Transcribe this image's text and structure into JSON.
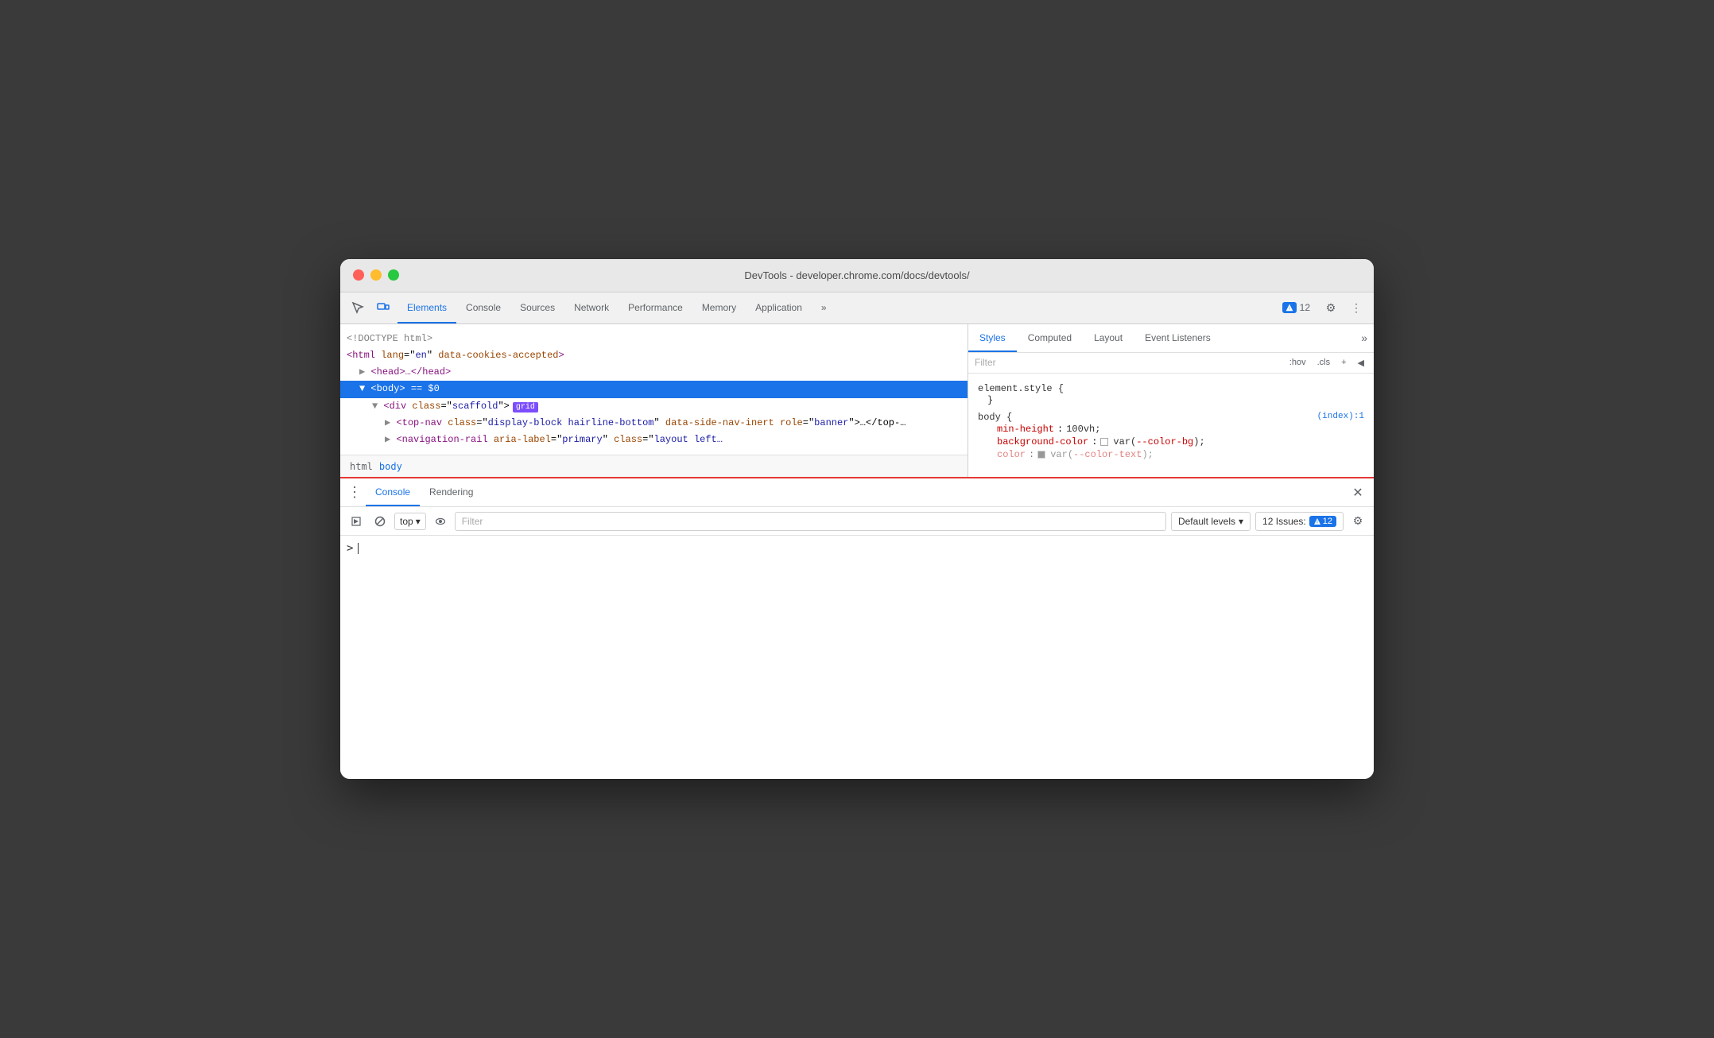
{
  "window": {
    "title": "DevTools - developer.chrome.com/docs/devtools/"
  },
  "titlebar": {
    "title": "DevTools - developer.chrome.com/docs/devtools/"
  },
  "toolbar": {
    "tabs": [
      {
        "id": "elements",
        "label": "Elements",
        "active": true
      },
      {
        "id": "console",
        "label": "Console",
        "active": false
      },
      {
        "id": "sources",
        "label": "Sources",
        "active": false
      },
      {
        "id": "network",
        "label": "Network",
        "active": false
      },
      {
        "id": "performance",
        "label": "Performance",
        "active": false
      },
      {
        "id": "memory",
        "label": "Memory",
        "active": false
      },
      {
        "id": "application",
        "label": "Application",
        "active": false
      }
    ],
    "more_label": "»",
    "issues_count": "12",
    "issues_label": "12 Issues:"
  },
  "elements": {
    "lines": [
      {
        "indent": 0,
        "content": "<!DOCTYPE html>",
        "type": "doctype"
      },
      {
        "indent": 0,
        "content": "<html lang=\"en\" data-cookies-accepted>",
        "type": "open-tag"
      },
      {
        "indent": 1,
        "content": "▶ <head>…</head>",
        "type": "collapsed"
      },
      {
        "indent": 1,
        "content": "▼ <body> == $0",
        "type": "selected"
      },
      {
        "indent": 2,
        "content": "▼ <div class=\"scaffold\">",
        "type": "open-tag",
        "badge": "grid"
      },
      {
        "indent": 3,
        "content": "▶ <top-nav class=\"display-block hairline-bottom\" data-side-nav-inert role=\"banner\">…</top-nav>",
        "type": "collapsed-long"
      },
      {
        "indent": 3,
        "content": "▶ <navigation-rail aria-label=\"primary\" class=\"layout left…",
        "type": "truncated"
      }
    ],
    "breadcrumbs": [
      "html",
      "body"
    ]
  },
  "styles": {
    "tabs": [
      {
        "id": "styles",
        "label": "Styles",
        "active": true
      },
      {
        "id": "computed",
        "label": "Computed",
        "active": false
      },
      {
        "id": "layout",
        "label": "Layout",
        "active": false
      },
      {
        "id": "event-listeners",
        "label": "Event Listeners",
        "active": false
      }
    ],
    "more_label": "»",
    "filter_placeholder": "Filter",
    "filter_actions": [
      ":hov",
      ".cls",
      "+",
      "◀"
    ],
    "rules": [
      {
        "selector": "element.style {",
        "close": "}",
        "origin": "",
        "properties": []
      },
      {
        "selector": "body {",
        "close": "}",
        "origin": "(index):1",
        "properties": [
          {
            "name": "min-height",
            "value": "100vh;"
          },
          {
            "name": "background-color",
            "value": "var(--color-bg);",
            "has_swatch": true,
            "swatch_color": "#ffffff"
          },
          {
            "name": "color",
            "value": "var(--color-text);",
            "has_swatch": true,
            "swatch_color": "#333333",
            "truncated": true
          }
        ]
      }
    ]
  },
  "console_drawer": {
    "tabs": [
      {
        "id": "console",
        "label": "Console",
        "active": true
      },
      {
        "id": "rendering",
        "label": "Rendering",
        "active": false
      }
    ],
    "toolbar": {
      "context_label": "top",
      "filter_placeholder": "Filter",
      "default_levels_label": "Default levels",
      "issues_label": "12 Issues:",
      "issues_count": "12"
    },
    "prompt": ">"
  },
  "icons": {
    "cursor": "↖",
    "layers": "⧉",
    "more": "»",
    "settings": "⚙",
    "kebab": "⋮",
    "play": "▶",
    "ban": "⊘",
    "eye": "👁",
    "chevron_down": "▾",
    "close": "✕",
    "info_badge": "ℹ"
  }
}
